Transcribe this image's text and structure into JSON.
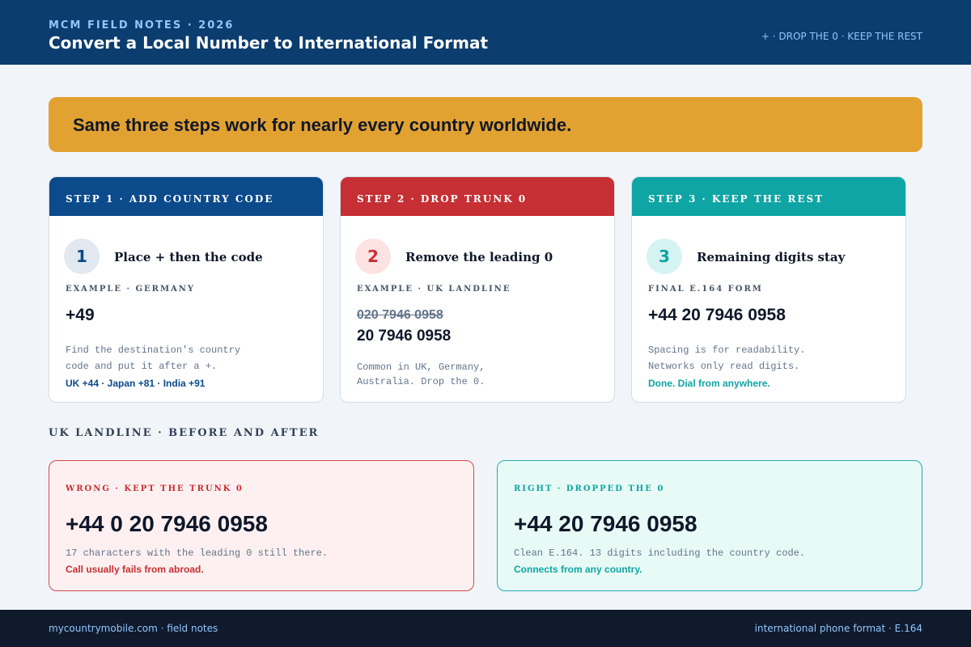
{
  "header": {
    "kicker": "MCM FIELD NOTES · 2026",
    "title": "Convert a Local Number to International Format",
    "tagline": "+ · DROP THE 0 · KEEP THE REST"
  },
  "banner": {
    "text": "Same three steps work for nearly every country worldwide."
  },
  "steps": [
    {
      "band": "STEP 1 · ADD COUNTRY CODE",
      "number": "1",
      "heading": "Place + then the code",
      "eyebrow": "EXAMPLE · GERMANY",
      "value": "+49",
      "desc": [
        "Find the destination's country",
        "code and put it after a +."
      ],
      "note": "UK +44 · Japan +81 · India +91"
    },
    {
      "band": "STEP 2 · DROP TRUNK 0",
      "number": "2",
      "heading": "Remove the leading 0",
      "eyebrow": "EXAMPLE · UK LANDLINE",
      "struck": "020 7946 0958",
      "value": "20 7946 0958",
      "desc": [
        "Common in UK, Germany,",
        "Australia. Drop the 0."
      ]
    },
    {
      "band": "STEP 3 · KEEP THE REST",
      "number": "3",
      "heading": "Remaining digits stay",
      "eyebrow": "FINAL E.164 FORM",
      "value": "+44 20 7946 0958",
      "desc": [
        "Spacing is for readability.",
        "Networks only read digits."
      ],
      "note": "Done. Dial from anywhere."
    }
  ],
  "comparison": {
    "title": "UK LANDLINE · BEFORE AND AFTER",
    "wrong": {
      "label": "WRONG · KEPT THE TRUNK 0",
      "number": "+44 0 20 7946 0958",
      "desc": "17 characters with the leading 0 still there.",
      "note": "Call usually fails from abroad."
    },
    "right": {
      "label": "RIGHT · DROPPED THE 0",
      "number": "+44 20 7946 0958",
      "desc": "Clean E.164. 13 digits including the country code.",
      "note": "Connects from any country."
    }
  },
  "footer": {
    "left": "mycountrymobile.com · field notes",
    "right": "international phone format · E.164"
  },
  "colors": {
    "header": "#0b3d6e",
    "banner": "#e2a232",
    "step1": "#0b4a8b",
    "step2": "#c62f33",
    "step3": "#0ea5a4",
    "footer": "#0f1b2d"
  }
}
